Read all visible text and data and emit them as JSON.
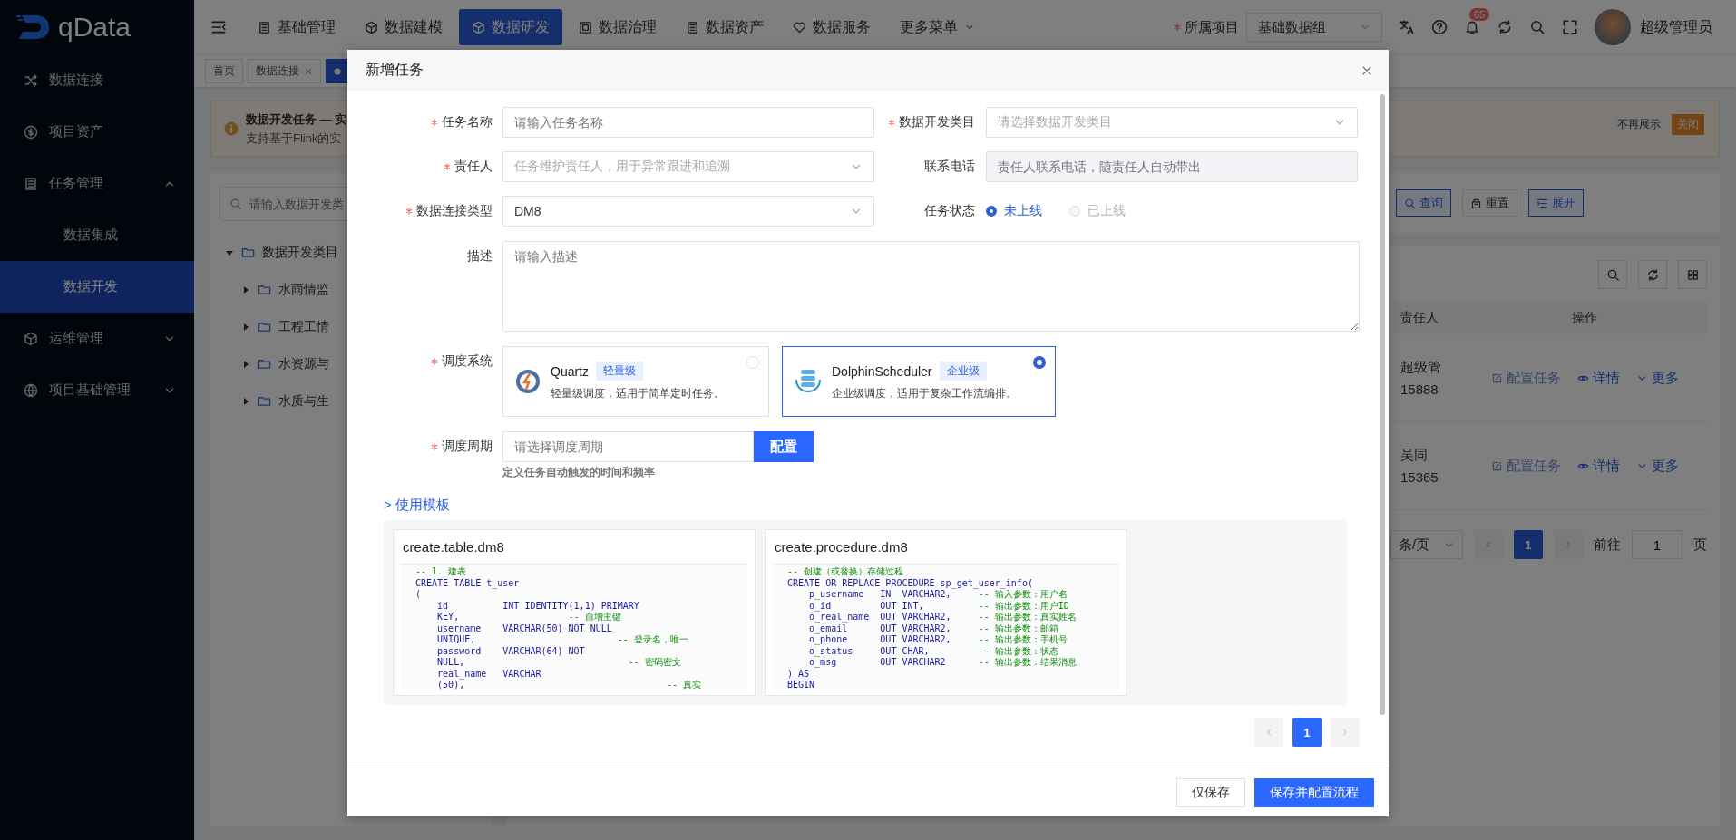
{
  "sidebar": {
    "logo": "qData",
    "items": [
      {
        "label": "数据连接",
        "selected": false
      },
      {
        "label": "项目资产",
        "selected": false
      },
      {
        "label": "任务管理",
        "expanded": true,
        "children": [
          {
            "label": "数据集成",
            "selected": false
          },
          {
            "label": "数据开发",
            "selected": true
          }
        ]
      },
      {
        "label": "运维管理",
        "expanded": false
      },
      {
        "label": "项目基础管理",
        "expanded": false
      }
    ]
  },
  "header": {
    "nav": [
      {
        "label": "基础管理",
        "selected": false,
        "dropdown": false
      },
      {
        "label": "数据建模",
        "selected": false,
        "dropdown": false
      },
      {
        "label": "数据研发",
        "selected": true,
        "dropdown": false
      },
      {
        "label": "数据治理",
        "selected": false,
        "dropdown": false
      },
      {
        "label": "数据资产",
        "selected": false,
        "dropdown": false
      },
      {
        "label": "数据服务",
        "selected": false,
        "dropdown": false
      },
      {
        "label": "更多菜单",
        "selected": false,
        "dropdown": true
      }
    ],
    "project": {
      "label": "所属项目",
      "required": true,
      "value": "基础数据组"
    },
    "notification_count": "65",
    "user_name": "超级管理员"
  },
  "tags": [
    {
      "label": "首页",
      "closable": false,
      "selected": false
    },
    {
      "label": "数据连接",
      "closable": true,
      "selected": false
    },
    {
      "closable": false,
      "selected": true
    }
  ],
  "alert": {
    "title": "数据开发任务 — 实",
    "text": "支持基于Flink的实",
    "actions": [
      {
        "label": "不再展示",
        "primary": false
      },
      {
        "label": "关闭",
        "primary": true
      }
    ]
  },
  "tree": {
    "search_placeholder": "请输入数据开发类",
    "nodes": [
      {
        "label": "数据开发类目",
        "expanded": true,
        "children": [
          {
            "label": "水雨情监",
            "expanded": false
          },
          {
            "label": "工程工情",
            "expanded": false
          },
          {
            "label": "水资源与",
            "expanded": false
          },
          {
            "label": "水质与生",
            "expanded": false
          }
        ]
      }
    ]
  },
  "query_buttons": [
    {
      "label": "查询",
      "primary": true
    },
    {
      "label": "重置",
      "primary": false
    },
    {
      "label": "展开",
      "primary": true
    }
  ],
  "table": {
    "columns": [
      "责任人",
      "操作"
    ],
    "rows": [
      {
        "owner": "超级管",
        "phone": "15888",
        "actions": [
          "配置任务",
          "详情",
          "更多"
        ]
      },
      {
        "owner": "吴同",
        "phone": "15365",
        "actions": [
          "配置任务",
          "详情",
          "更多"
        ]
      }
    ]
  },
  "pagination": {
    "page_size": "条/页",
    "pages": [
      {
        "label": "1",
        "selected": true
      }
    ],
    "goto_label": "前往",
    "goto_value": "1",
    "goto_suffix": "页"
  },
  "dialog": {
    "title": "新增任务",
    "fields": [
      {
        "kind": "input",
        "label": "任务名称",
        "required": true,
        "placeholder": "请输入任务名称",
        "disabled": false
      },
      {
        "kind": "select",
        "label": "数据开发类目",
        "required": true,
        "placeholder": "请选择数据开发类目",
        "disabled": false
      },
      {
        "kind": "select",
        "label": "责任人",
        "required": true,
        "placeholder": "任务维护责任人，用于异常跟进和追溯",
        "disabled": false
      },
      {
        "kind": "input",
        "label": "联系电话",
        "required": false,
        "placeholder": "责任人联系电话，随责任人自动带出",
        "disabled": true
      },
      {
        "kind": "select",
        "label": "数据连接类型",
        "required": true,
        "value": "DM8",
        "disabled": false
      },
      {
        "kind": "radio",
        "label": "任务状态",
        "required": false,
        "options": [
          {
            "label": "未上线",
            "selected": true,
            "disabled": false
          },
          {
            "label": "已上线",
            "selected": false,
            "disabled": true
          }
        ]
      }
    ],
    "description": {
      "label": "描述",
      "required": false,
      "placeholder": "请输入描述"
    },
    "scheduler": {
      "label": "调度系统",
      "required": true,
      "options": [
        {
          "name": "Quartz",
          "tag": "轻量级",
          "description": "轻量级调度，适用于简单定时任务。",
          "selected": false
        },
        {
          "name": "DolphinScheduler",
          "tag": "企业级",
          "description": "企业级调度，适用于复杂工作流编排。",
          "selected": true
        }
      ]
    },
    "cycle": {
      "label": "调度周期",
      "required": true,
      "placeholder": "请选择调度周期",
      "button": "配置",
      "hint": "定义任务自动触发的时间和频率"
    },
    "templates": {
      "toggle": "> 使用模板",
      "items": [
        {
          "name": "create.table.dm8",
          "lines": [
            {
              "comment": "-- 1. 建表"
            },
            {
              "code": "CREATE TABLE t_user"
            },
            {
              "code": "("
            },
            {
              "code": "    id          INT IDENTITY(1,1) PRIMARY"
            },
            {
              "code": "    KEY,                    ",
              "comment": "-- 自增主键"
            },
            {
              "code": "    username    VARCHAR(50) NOT NULL"
            },
            {
              "code": "    UNIQUE,                          ",
              "comment": "-- 登录名，唯一"
            },
            {
              "code": "    password    VARCHAR(64) NOT"
            },
            {
              "code": "    NULL,                              ",
              "comment": "-- 密码密文"
            },
            {
              "code": "    real_name   VARCHAR"
            },
            {
              "code": "    (50),                                     ",
              "comment": "-- 真实"
            }
          ]
        },
        {
          "name": "create.procedure.dm8",
          "lines": [
            {
              "comment": "-- 创建（或替换）存储过程"
            },
            {
              "code": "CREATE OR REPLACE PROCEDURE sp_get_user_info("
            },
            {
              "code": "    p_username   IN  VARCHAR2,     ",
              "comment": "-- 输入参数：用户名"
            },
            {
              "code": "    o_id         OUT INT,          ",
              "comment": "-- 输出参数：用户ID"
            },
            {
              "code": "    o_real_name  OUT VARCHAR2,     ",
              "comment": "-- 输出参数：真实姓名"
            },
            {
              "code": "    o_email      OUT VARCHAR2,     ",
              "comment": "-- 输出参数：邮箱"
            },
            {
              "code": "    o_phone      OUT VARCHAR2,     ",
              "comment": "-- 输出参数：手机号"
            },
            {
              "code": "    o_status     OUT CHAR,         ",
              "comment": "-- 输出参数：状态"
            },
            {
              "code": "    o_msg        OUT VARCHAR2      ",
              "comment": "-- 输出参数：结果消息"
            },
            {
              "code": ") AS"
            },
            {
              "code": "BEGIN"
            }
          ]
        }
      ],
      "pagination": {
        "pages": [
          {
            "label": "1",
            "selected": true
          }
        ]
      }
    },
    "footer_buttons": [
      {
        "label": "仅保存",
        "primary": false
      },
      {
        "label": "保存并配置流程",
        "primary": true
      }
    ]
  }
}
